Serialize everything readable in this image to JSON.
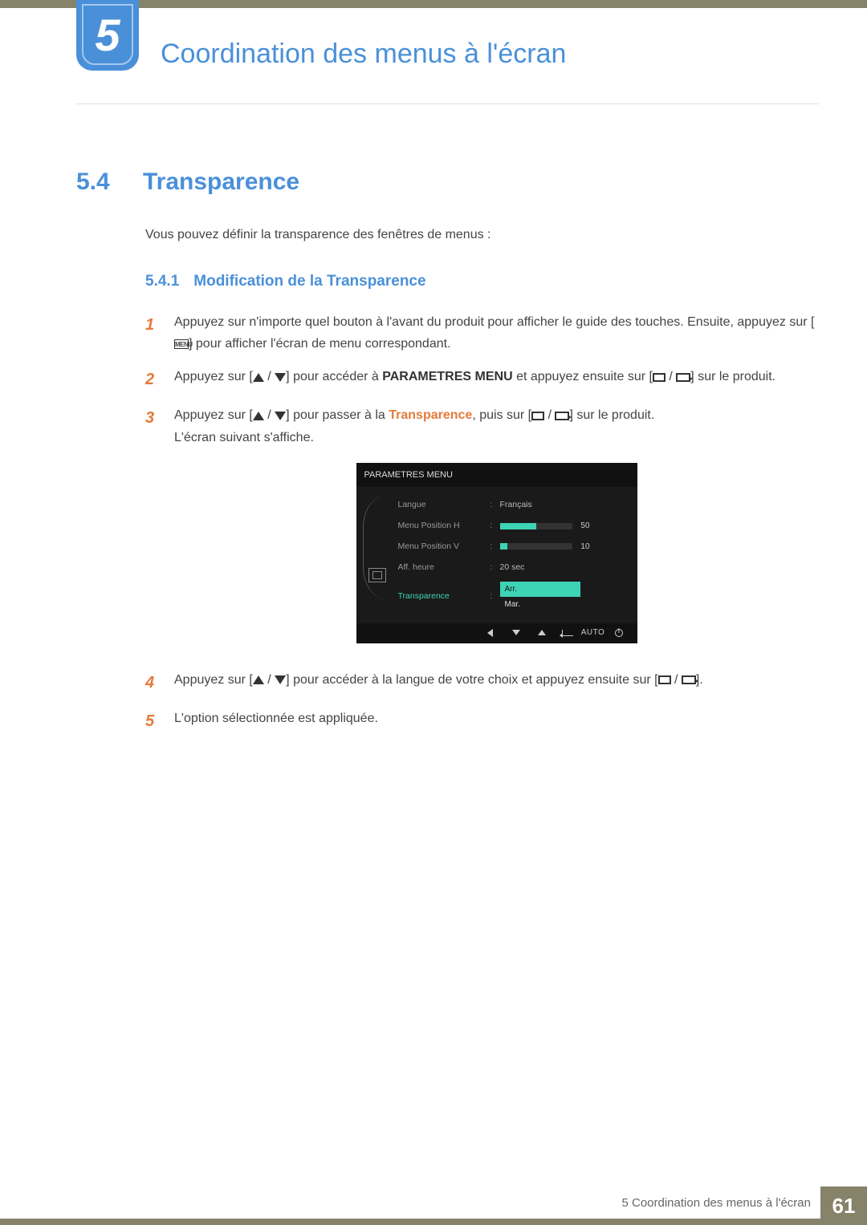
{
  "chapter": {
    "number": "5",
    "title": "Coordination des menus à l'écran"
  },
  "section": {
    "number": "5.4",
    "title": "Transparence",
    "intro": "Vous pouvez définir la transparence des fenêtres de menus :"
  },
  "subsection": {
    "number": "5.4.1",
    "title": "Modification de la Transparence"
  },
  "steps": {
    "s1a": "Appuyez sur n'importe quel bouton à l'avant du produit pour afficher le guide des touches. Ensuite, appuyez sur [",
    "s1_menu": "MENU",
    "s1b": "] pour afficher l'écran de menu correspondant.",
    "s2a": "Appuyez sur [",
    "s2b": "] pour accéder à ",
    "s2_param": "PARAMETRES MENU",
    "s2c": " et appuyez ensuite sur [",
    "s2d": "] sur le produit.",
    "s3a": "Appuyez sur [",
    "s3b": "] pour passer à la ",
    "s3_trans": "Transparence",
    "s3c": ", puis sur [",
    "s3d": "] sur le produit.",
    "s3e": "L'écran suivant s'affiche.",
    "s4a": "Appuyez sur [",
    "s4b": "] pour accéder à la langue de votre choix et appuyez ensuite sur [",
    "s4c": "].",
    "s5": "L'option sélectionnée est appliquée."
  },
  "step_nums": {
    "n1": "1",
    "n2": "2",
    "n3": "3",
    "n4": "4",
    "n5": "5"
  },
  "osd": {
    "title": "PARAMETRES MENU",
    "rows": {
      "langue": {
        "label": "Langue",
        "value": "Français"
      },
      "posH": {
        "label": "Menu Position H",
        "value": "50",
        "fill": 50
      },
      "posV": {
        "label": "Menu Position V",
        "value": "10",
        "fill": 10
      },
      "aff": {
        "label": "Aff. heure",
        "value": "20 sec"
      },
      "trans": {
        "label": "Transparence",
        "opt1": "Arr.",
        "opt2": "Mar."
      }
    },
    "keys": {
      "auto": "AUTO"
    }
  },
  "footer": {
    "text": "5 Coordination des menus à l'écran",
    "page": "61"
  }
}
